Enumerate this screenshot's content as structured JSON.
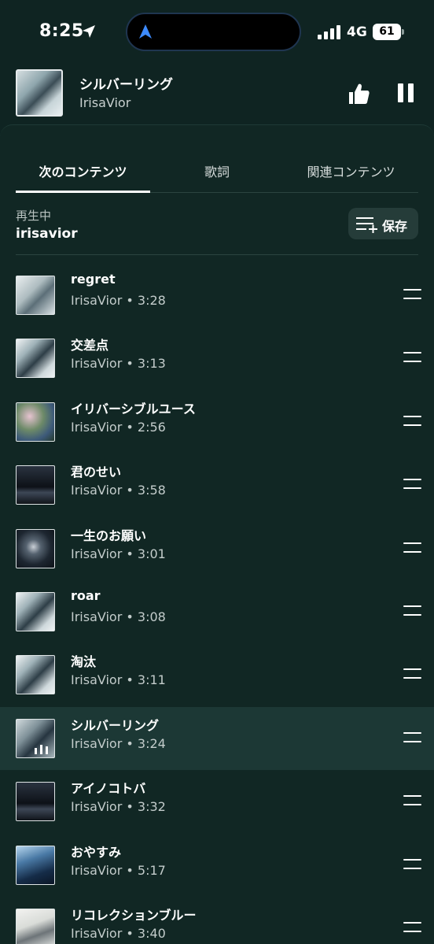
{
  "status": {
    "time": "8:25",
    "network": "4G",
    "battery": "61"
  },
  "mini_player": {
    "title": "シルバーリング",
    "artist": "IrisaVior"
  },
  "tabs": [
    {
      "label": "次のコンテンツ",
      "active": true
    },
    {
      "label": "歌詞",
      "active": false
    },
    {
      "label": "関連コンテンツ",
      "active": false
    }
  ],
  "queue_header": {
    "label": "再生中",
    "source": "irisavior",
    "save_label": "保存"
  },
  "queue": [
    {
      "title": "regret",
      "meta": "IrisaVior • 3:28",
      "art": "art-a",
      "current": false
    },
    {
      "title": "交差点",
      "meta": "IrisaVior • 3:13",
      "art": "art-b",
      "current": false
    },
    {
      "title": "イリバーシブルユース",
      "meta": "IrisaVior • 2:56",
      "art": "art-c",
      "current": false
    },
    {
      "title": "君のせい",
      "meta": "IrisaVior • 3:58",
      "art": "art-d",
      "current": false
    },
    {
      "title": "一生のお願い",
      "meta": "IrisaVior • 3:01",
      "art": "art-e",
      "current": false
    },
    {
      "title": "roar",
      "meta": "IrisaVior • 3:08",
      "art": "art-b",
      "current": false
    },
    {
      "title": "淘汰",
      "meta": "IrisaVior • 3:11",
      "art": "art-b",
      "current": false
    },
    {
      "title": "シルバーリング",
      "meta": "IrisaVior • 3:24",
      "art": "art-h",
      "current": true
    },
    {
      "title": "アイノコトバ",
      "meta": "IrisaVior • 3:32",
      "art": "art-d",
      "current": false
    },
    {
      "title": "おやすみ",
      "meta": "IrisaVior • 5:17",
      "art": "art-f",
      "current": false
    },
    {
      "title": "リコレクションブルー",
      "meta": "IrisaVior • 3:40",
      "art": "art-g",
      "current": false
    }
  ],
  "colors": {
    "background": "#0f2422",
    "sheet": "#112724",
    "current_row": "#1c3835",
    "save_button": "#253c39"
  }
}
